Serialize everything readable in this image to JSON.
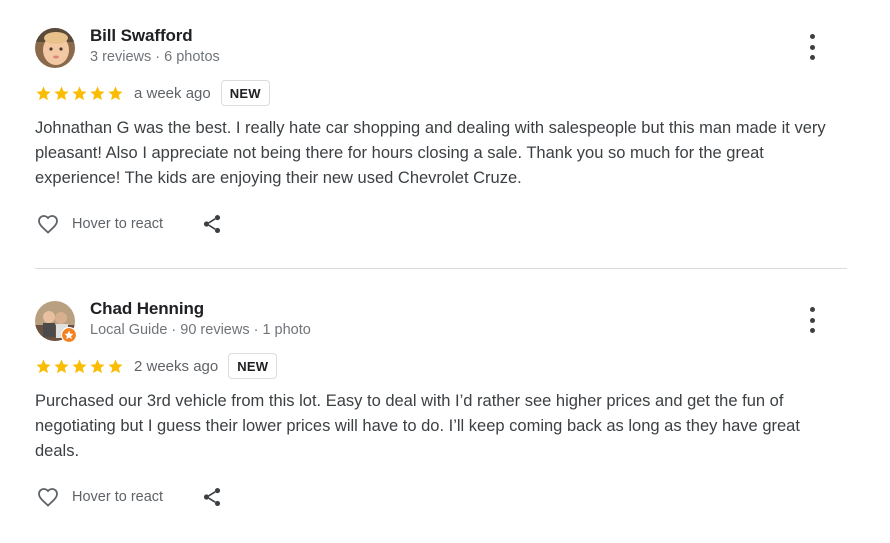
{
  "accent": {
    "star": "#fbbc04",
    "guide_badge": "#f4811f"
  },
  "reviews": [
    {
      "name": "Bill Swafford",
      "meta": "3 reviews · 6 photos",
      "rating": 5,
      "time": "a week ago",
      "badge": "NEW",
      "text": "Johnathan G was the best. I really hate car shopping and dealing with salespeople but this man made it very pleasant! Also I appreciate not being there for hours closing a sale. Thank you so much for the great experience! The kids are enjoying their new used Chevrolet Cruze.",
      "react_label": "Hover to react",
      "icons": {
        "more": "more-vert-icon",
        "react": "heart-icon",
        "share": "share-icon"
      }
    },
    {
      "name": "Chad Henning",
      "meta": "Local Guide · 90 reviews · 1 photo",
      "rating": 5,
      "time": "2 weeks ago",
      "badge": "NEW",
      "text": "Purchased our 3rd vehicle from this lot. Easy to deal with I’d rather see higher prices and get the fun of negotiating but I guess their lower prices will have to do. I’ll keep coming back as long as they have great deals.",
      "react_label": "Hover to react",
      "icons": {
        "more": "more-vert-icon",
        "react": "heart-icon",
        "share": "share-icon"
      }
    }
  ]
}
